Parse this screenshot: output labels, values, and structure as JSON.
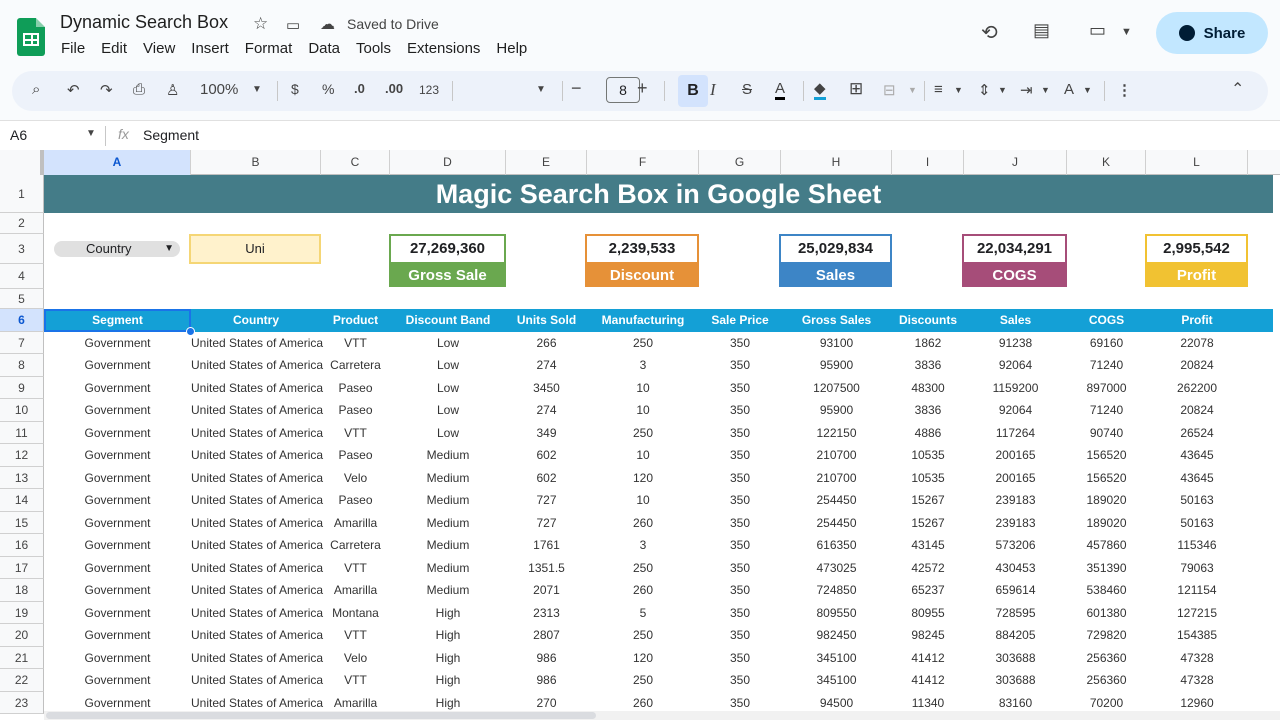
{
  "app": {
    "doc_title": "Dynamic Search Box",
    "saved_status": "Saved to Drive",
    "share_label": "Share",
    "menu": [
      "File",
      "Edit",
      "View",
      "Insert",
      "Format",
      "Data",
      "Tools",
      "Extensions",
      "Help"
    ]
  },
  "toolbar": {
    "zoom": "100%",
    "currency": "$",
    "percent": "%",
    "dec_decrease": ".0",
    "dec_increase": ".00",
    "number_format": "123",
    "font_size": "8",
    "bold": "B",
    "italic": "I",
    "strike": "S",
    "text_color": "A"
  },
  "formula_bar": {
    "cell_ref": "A6",
    "fx": "fx",
    "content": "Segment"
  },
  "columns": [
    "A",
    "B",
    "C",
    "D",
    "E",
    "F",
    "G",
    "H",
    "I",
    "J",
    "K",
    "L"
  ],
  "rows": [
    "1",
    "2",
    "3",
    "4",
    "5",
    "6",
    "7",
    "8",
    "9",
    "10",
    "11",
    "12",
    "13",
    "14",
    "15",
    "16",
    "17",
    "18",
    "19",
    "20",
    "21",
    "22",
    "23"
  ],
  "sheet": {
    "banner": "Magic Search Box in Google Sheet",
    "dropdown_value": "Country",
    "search_value": "Uni",
    "kpis": [
      {
        "value": "27,269,360",
        "label": "Gross Sale",
        "color": "#6aa84f"
      },
      {
        "value": "2,239,533",
        "label": "Discount",
        "color": "#e69138"
      },
      {
        "value": "25,029,834",
        "label": "Sales",
        "color": "#3d85c6"
      },
      {
        "value": "22,034,291",
        "label": "COGS",
        "color": "#a64d79"
      },
      {
        "value": "2,995,542",
        "label": "Profit",
        "color": "#f1c232"
      }
    ],
    "headers": [
      "Segment",
      "Country",
      "Product",
      "Discount Band",
      "Units Sold",
      "Manufacturing Price",
      "Sale Price",
      "Gross Sales",
      "Discounts",
      "Sales",
      "COGS",
      "Profit"
    ],
    "data": [
      [
        "Government",
        "United States of America",
        "VTT",
        "Low",
        "266",
        "250",
        "350",
        "93100",
        "1862",
        "91238",
        "69160",
        "22078"
      ],
      [
        "Government",
        "United States of America",
        "Carretera",
        "Low",
        "274",
        "3",
        "350",
        "95900",
        "3836",
        "92064",
        "71240",
        "20824"
      ],
      [
        "Government",
        "United States of America",
        "Paseo",
        "Low",
        "3450",
        "10",
        "350",
        "1207500",
        "48300",
        "1159200",
        "897000",
        "262200"
      ],
      [
        "Government",
        "United States of America",
        "Paseo",
        "Low",
        "274",
        "10",
        "350",
        "95900",
        "3836",
        "92064",
        "71240",
        "20824"
      ],
      [
        "Government",
        "United States of America",
        "VTT",
        "Low",
        "349",
        "250",
        "350",
        "122150",
        "4886",
        "117264",
        "90740",
        "26524"
      ],
      [
        "Government",
        "United States of America",
        "Paseo",
        "Medium",
        "602",
        "10",
        "350",
        "210700",
        "10535",
        "200165",
        "156520",
        "43645"
      ],
      [
        "Government",
        "United States of America",
        "Velo",
        "Medium",
        "602",
        "120",
        "350",
        "210700",
        "10535",
        "200165",
        "156520",
        "43645"
      ],
      [
        "Government",
        "United States of America",
        "Paseo",
        "Medium",
        "727",
        "10",
        "350",
        "254450",
        "15267",
        "239183",
        "189020",
        "50163"
      ],
      [
        "Government",
        "United States of America",
        "Amarilla",
        "Medium",
        "727",
        "260",
        "350",
        "254450",
        "15267",
        "239183",
        "189020",
        "50163"
      ],
      [
        "Government",
        "United States of America",
        "Carretera",
        "Medium",
        "1761",
        "3",
        "350",
        "616350",
        "43145",
        "573206",
        "457860",
        "115346"
      ],
      [
        "Government",
        "United States of America",
        "VTT",
        "Medium",
        "1351.5",
        "250",
        "350",
        "473025",
        "42572",
        "430453",
        "351390",
        "79063"
      ],
      [
        "Government",
        "United States of America",
        "Amarilla",
        "Medium",
        "2071",
        "260",
        "350",
        "724850",
        "65237",
        "659614",
        "538460",
        "121154"
      ],
      [
        "Government",
        "United States of America",
        "Montana",
        "High",
        "2313",
        "5",
        "350",
        "809550",
        "80955",
        "728595",
        "601380",
        "127215"
      ],
      [
        "Government",
        "United States of America",
        "VTT",
        "High",
        "2807",
        "250",
        "350",
        "982450",
        "98245",
        "884205",
        "729820",
        "154385"
      ],
      [
        "Government",
        "United States of America",
        "Velo",
        "High",
        "986",
        "120",
        "350",
        "345100",
        "41412",
        "303688",
        "256360",
        "47328"
      ],
      [
        "Government",
        "United States of America",
        "VTT",
        "High",
        "986",
        "250",
        "350",
        "345100",
        "41412",
        "303688",
        "256360",
        "47328"
      ],
      [
        "Government",
        "United States of America",
        "Amarilla",
        "High",
        "270",
        "260",
        "350",
        "94500",
        "11340",
        "83160",
        "70200",
        "12960"
      ]
    ]
  }
}
